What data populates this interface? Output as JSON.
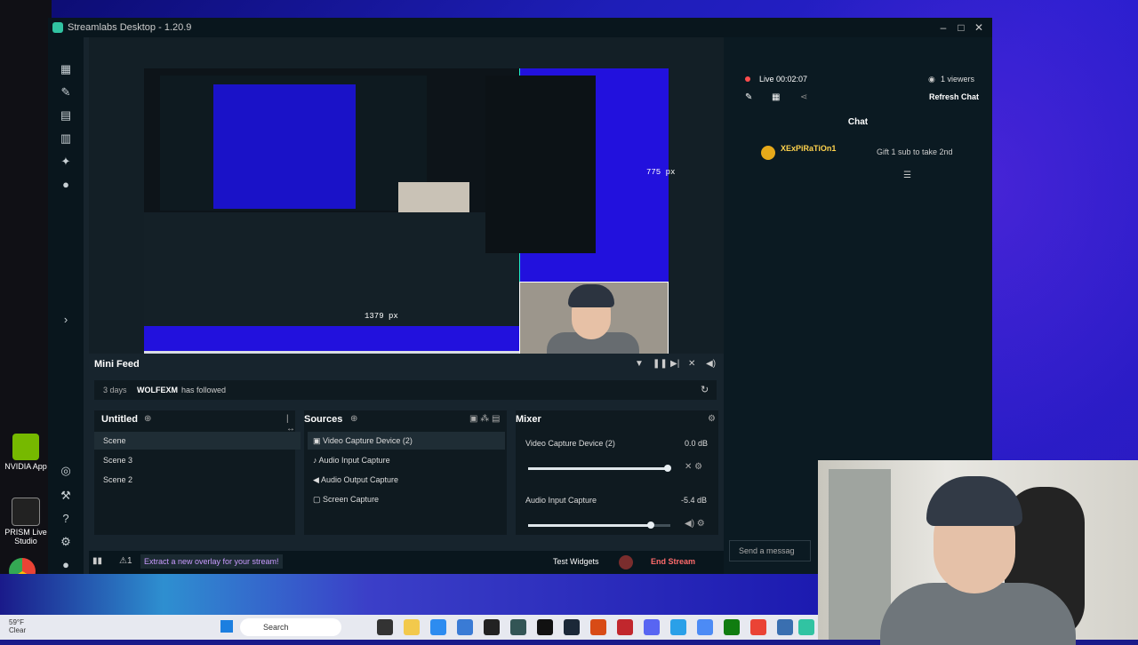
{
  "window": {
    "title": "Streamlabs Desktop - 1.20.9"
  },
  "preview": {
    "height_label": "775 px",
    "width_label": "1379 px"
  },
  "minifeed": {
    "title": "Mini Feed",
    "event": {
      "time": "3 days",
      "user": "WOLFEXM",
      "action": "has followed"
    }
  },
  "scenes": {
    "title": "Untitled",
    "items": [
      {
        "label": "Scene",
        "selected": true
      },
      {
        "label": "Scene 3",
        "selected": false
      },
      {
        "label": "Scene 2",
        "selected": false
      }
    ]
  },
  "sources": {
    "title": "Sources",
    "items": [
      {
        "label": "Video Capture Device (2)",
        "icon": "camera-icon",
        "selected": true
      },
      {
        "label": "Audio Input Capture",
        "icon": "microphone-icon",
        "selected": false
      },
      {
        "label": "Audio Output Capture",
        "icon": "speaker-icon",
        "selected": false
      },
      {
        "label": "Screen Capture",
        "icon": "screen-icon",
        "selected": false
      }
    ]
  },
  "mixer": {
    "title": "Mixer",
    "channels": [
      {
        "name": "Video Capture Device (2)",
        "db": "0.0 dB",
        "level": 0.98
      },
      {
        "name": "Audio Input Capture",
        "db": "-5.4 dB",
        "level": 0.86
      }
    ]
  },
  "footer": {
    "tip": "Extract a new overlay for your stream!",
    "test_widgets": "Test Widgets",
    "end_stream": "End Stream"
  },
  "chat": {
    "live_timer": "Live 00:02:07",
    "viewers": "1 viewers",
    "refresh": "Refresh Chat",
    "title": "Chat",
    "message": {
      "user": "XExPiRaTiOn1",
      "text": "Gift 1 sub to take 2nd"
    },
    "input_placeholder": "Send a messag"
  },
  "taskbar": {
    "weather_temp": "59°F",
    "weather_desc": "Clear",
    "search": "Search"
  },
  "desktop_icons": [
    {
      "label": "NVIDIA App"
    },
    {
      "label": "PRISM Live Studio"
    }
  ],
  "colors": {
    "accent": "#31c3a2",
    "end_stream": "#ff6b6b",
    "live": "#ff4d4d"
  }
}
